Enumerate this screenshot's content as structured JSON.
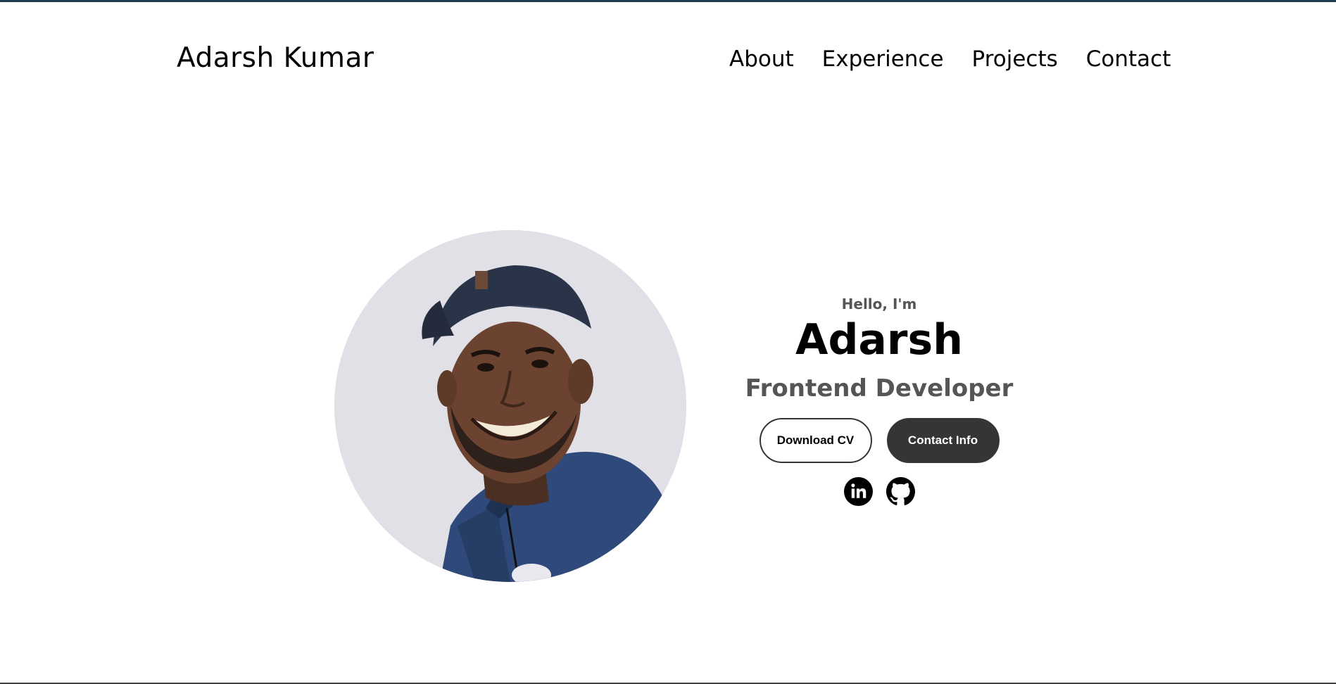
{
  "header": {
    "logo": "Adarsh Kumar",
    "nav": [
      "About",
      "Experience",
      "Projects",
      "Contact"
    ]
  },
  "hero": {
    "greeting": "Hello, I'm",
    "name": "Adarsh",
    "title": "Frontend Developer",
    "buttons": {
      "download_cv": "Download CV",
      "contact_info": "Contact Info"
    },
    "socials": [
      {
        "icon": "linkedin-icon"
      },
      {
        "icon": "github-icon"
      }
    ],
    "profile_photo": "profile-picture"
  },
  "colors": {
    "text": "#000000",
    "muted": "#555555",
    "dark_button": "#353535",
    "photo_bg": "#e0e0e6",
    "jacket": "#2f4a7a"
  }
}
